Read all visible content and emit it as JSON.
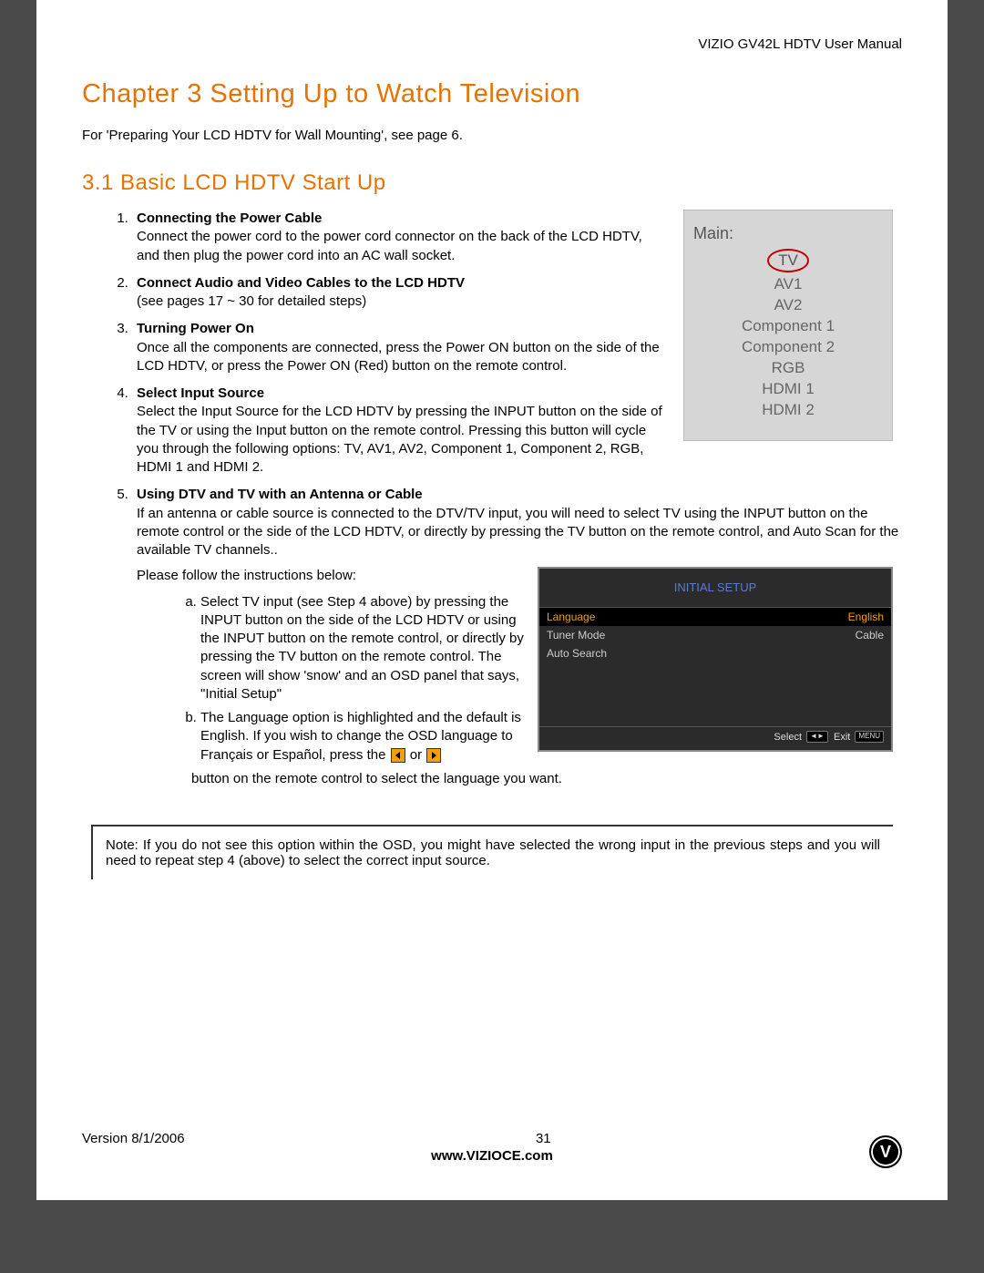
{
  "header": {
    "product": "VIZIO GV42L HDTV User Manual"
  },
  "chapter": {
    "title": "Chapter 3 Setting Up to Watch Television"
  },
  "intro": "For 'Preparing Your LCD HDTV for Wall Mounting', see page 6.",
  "section": {
    "title": "3.1 Basic LCD HDTV Start Up"
  },
  "steps": [
    {
      "title": "Connecting the Power Cable",
      "body": "Connect the power cord to the power cord connector on the back of the LCD HDTV, and then plug the power cord into an AC wall socket."
    },
    {
      "title": "Connect Audio and Video Cables to the LCD HDTV",
      "body": "(see pages 17 ~ 30 for detailed steps)"
    },
    {
      "title": "Turning Power On",
      "body": "Once all the components are connected, press the Power ON button on the side of the LCD HDTV, or press the Power ON (Red) button on the remote control."
    },
    {
      "title": "Select Input Source",
      "body": "Select the Input Source for the LCD HDTV by pressing the INPUT button on the side of the TV or using the Input button on the remote control.  Pressing this button will cycle you through the following options: TV, AV1, AV2, Component 1, Component 2,  RGB, HDMI 1 and HDMI 2."
    },
    {
      "title": "Using DTV and TV with an Antenna or Cable",
      "body": "If an antenna or cable source is connected to the DTV/TV input, you will need to select TV using the INPUT button on the remote control or the side of the LCD HDTV, or directly by pressing the TV button on the remote control, and Auto Scan for the available TV channels.."
    }
  ],
  "follow_intro": "Please follow the instructions below:",
  "substeps": [
    "Select TV input (see Step 4 above) by pressing the INPUT button on the side of the LCD HDTV or using the INPUT button on the remote control, or directly by pressing the TV button on the remote control.  The screen will show 'snow' and an OSD panel that says, \"Initial Setup\"",
    "The Language option is highlighted and the default is English.  If you wish to change the OSD language to Français or Español, press the"
  ],
  "substep_b_tail_mid": "or",
  "substep_b_after": "button on the remote control to select the language you want.",
  "inputs_menu": {
    "label": "Main:",
    "selected": "TV",
    "items": [
      "AV1",
      "AV2",
      "Component 1",
      "Component 2",
      "RGB",
      "HDMI 1",
      "HDMI 2"
    ]
  },
  "osd": {
    "title": "INITIAL  SETUP",
    "rows": [
      {
        "label": "Language",
        "value": "English",
        "highlight": true
      },
      {
        "label": "Tuner Mode",
        "value": "Cable",
        "highlight": false
      },
      {
        "label": "Auto Search",
        "value": "",
        "highlight": false
      }
    ],
    "footer_select": "Select",
    "footer_exit": "Exit",
    "footer_btn1": "◄►",
    "footer_btn2": "MENU"
  },
  "note": "Note: If you do not see this option within the OSD, you might have selected the wrong input in the previous steps and you will need to repeat step 4 (above) to select the correct input source.",
  "footer": {
    "version": "Version 8/1/2006",
    "page": "31",
    "site": "www.VIZIOCE.com"
  },
  "logo_letter": "V"
}
